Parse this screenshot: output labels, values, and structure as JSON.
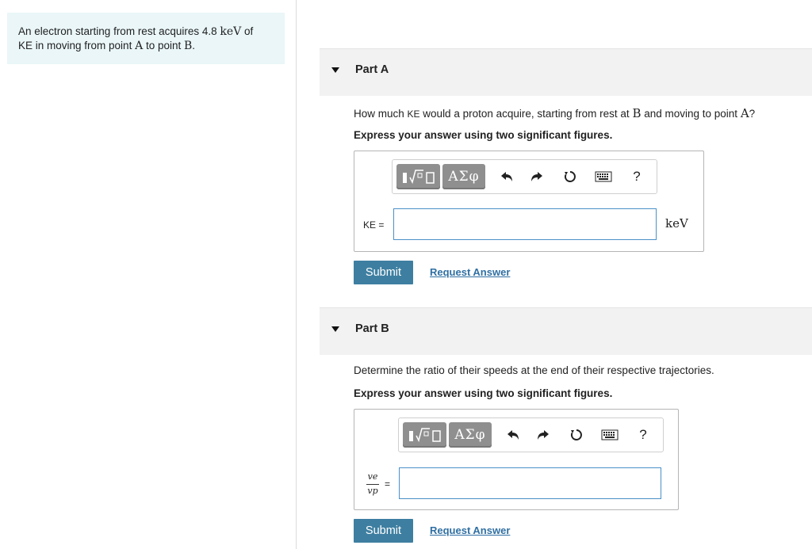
{
  "problem": {
    "text_1": "An electron starting from rest acquires 4.8 ",
    "unit_kev": "keV",
    "text_2": " of",
    "ke_label": "KE",
    "text_3": " in moving from point ",
    "point_a": "A",
    "text_4": " to point ",
    "point_b": "B",
    "text_5": "."
  },
  "part_a": {
    "title": "Part A",
    "question_1": "How much ",
    "question_ke": "KE",
    "question_2": " would a proton acquire, starting from rest at ",
    "question_b": "B",
    "question_3": " and moving to point ",
    "question_a": "A",
    "question_4": "?",
    "instruction": "Express your answer using two significant figures.",
    "input_label": "KE =",
    "input_value": "",
    "unit": "keV",
    "submit_label": "Submit",
    "request_label": "Request Answer"
  },
  "part_b": {
    "title": "Part B",
    "question": "Determine the ratio of their speeds at the end of their respective trajectories.",
    "instruction": "Express your answer using two significant figures.",
    "frac_num": "ve",
    "frac_den": "vp",
    "equals": "=",
    "input_value": "",
    "submit_label": "Submit",
    "request_label": "Request Answer"
  },
  "toolbar": {
    "greek_label": "ΑΣφ",
    "help_label": "?",
    "icons": [
      "templates-icon",
      "greek-symbols-icon",
      "undo-icon",
      "redo-icon",
      "reset-icon",
      "keyboard-icon",
      "help-icon"
    ]
  }
}
